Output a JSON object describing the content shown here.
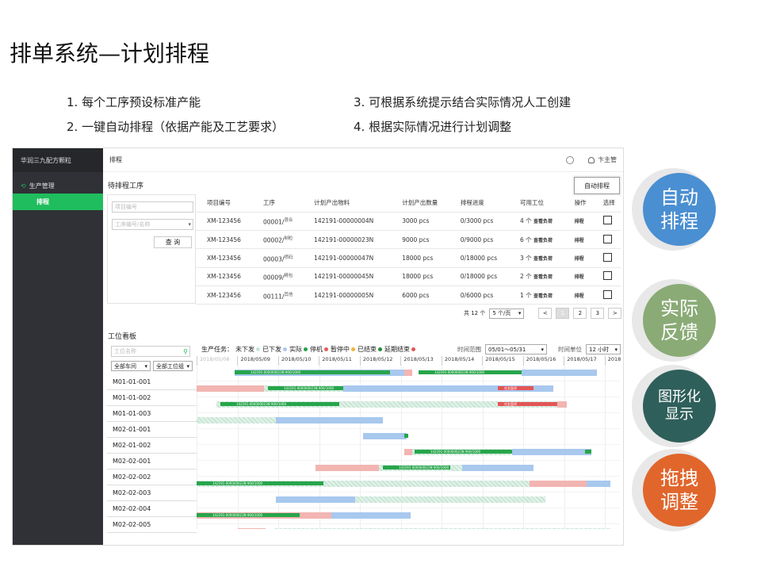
{
  "slide": {
    "title": "排单系统—计划排程",
    "bullets": [
      "1. 每个工序预设标准产能",
      "2. 一键自动排程（依据产能及工艺要求）",
      "3. 可根据系统提示结合实际情况人工创建",
      "4. 根据实际情况进行计划调整"
    ]
  },
  "sidebar": {
    "brand": "华润三九配方颗粒",
    "group": "生产管理",
    "active_item": "排程"
  },
  "topbar": {
    "title": "排程",
    "user": "卞主管"
  },
  "pending": {
    "title": "待排程工序",
    "auto_button": "自动排程",
    "filter": {
      "project_placeholder": "项目编号",
      "process_placeholder": "工序编号/名称",
      "query_button": "查 询"
    },
    "columns": [
      "项目编号",
      "工序",
      "计划产出物料",
      "计划产出数量",
      "排程进度",
      "可用工位",
      "操作",
      "选择"
    ],
    "rows": [
      {
        "project": "XM-123456",
        "process": "00001/",
        "process_name": "混合",
        "material": "142191-00000004N",
        "qty": "3000 pcs",
        "progress": "0/3000 pcs",
        "stations": "4 个",
        "view": "查看负荷",
        "action": "排程"
      },
      {
        "project": "XM-123456",
        "process": "00002/",
        "process_name": "制粒",
        "material": "142191-00000023N",
        "qty": "9000 pcs",
        "progress": "0/9000 pcs",
        "stations": "6 个",
        "view": "查看负荷",
        "action": "排程"
      },
      {
        "project": "XM-123456",
        "process": "00003/",
        "process_name": "喷码",
        "material": "142191-00000047N",
        "qty": "18000 pcs",
        "progress": "0/18000 pcs",
        "stations": "3 个",
        "view": "查看负荷",
        "action": "排程"
      },
      {
        "project": "XM-123456",
        "process": "00009/",
        "process_name": "精包",
        "material": "142191-00000045N",
        "qty": "18000 pcs",
        "progress": "0/18000 pcs",
        "stations": "2 个",
        "view": "查看负荷",
        "action": "排程"
      },
      {
        "project": "XM-123456",
        "process": "00111/",
        "process_name": "其他",
        "material": "142191-00000005N",
        "qty": "6000 pcs",
        "progress": "0/6000 pcs",
        "stations": "1 个",
        "view": "查看负荷",
        "action": "排程"
      }
    ],
    "pager": {
      "total": "共 12 个",
      "page_size": "5 个/页",
      "prev": "<",
      "pages": [
        "1",
        "2",
        "3"
      ],
      "next": ">"
    }
  },
  "board": {
    "title": "工位看板",
    "search_placeholder": "工位名称",
    "workshop_select": "全部车间",
    "group_select": "全部工位组",
    "legend_label": "生产任务：",
    "legend": [
      {
        "label": "未下发",
        "color": "#c8e6d5"
      },
      {
        "label": "已下发",
        "color": "#a8c8ee"
      },
      {
        "label": "实际",
        "color": "#1fa34a"
      },
      {
        "label": "停机",
        "color": "#e15b5b"
      },
      {
        "label": "暂停中",
        "color": "#f0b63a"
      },
      {
        "label": "已结束",
        "color": "#2a8c3a"
      },
      {
        "label": "延期结束",
        "color": "#e05656"
      }
    ],
    "time_range_label": "时间范围",
    "time_range": "05/01～05/31",
    "time_unit_label": "时间单位",
    "time_unit": "12 小时",
    "dates": [
      "2018/05/08",
      "2018/05/09",
      "2018/05/10",
      "2018/05/11",
      "2018/05/12",
      "2018/05/13",
      "2018/05/14",
      "2018/05/15",
      "2018/05/16",
      "2018/05/17",
      "2018"
    ],
    "stations": [
      "M01-01-001",
      "M01-01-002",
      "M01-01-003",
      "M02-01-001",
      "M02-01-002",
      "M02-02-001",
      "M02-02-002",
      "M02-02-003",
      "M02-02-004",
      "M02-02-005"
    ],
    "bar_text": "142191-000000023N 900/1000",
    "tag_text": "任务暂停"
  },
  "badges": [
    {
      "line1": "自动",
      "line2": "排程",
      "color": "#4a8fd1"
    },
    {
      "line1": "实际",
      "line2": "反馈",
      "color": "#8aab76"
    },
    {
      "line1": "图形化",
      "line2": "显示",
      "color": "#2f5f5a"
    },
    {
      "line1": "拖拽",
      "line2": "调整",
      "color": "#e0662c"
    }
  ]
}
